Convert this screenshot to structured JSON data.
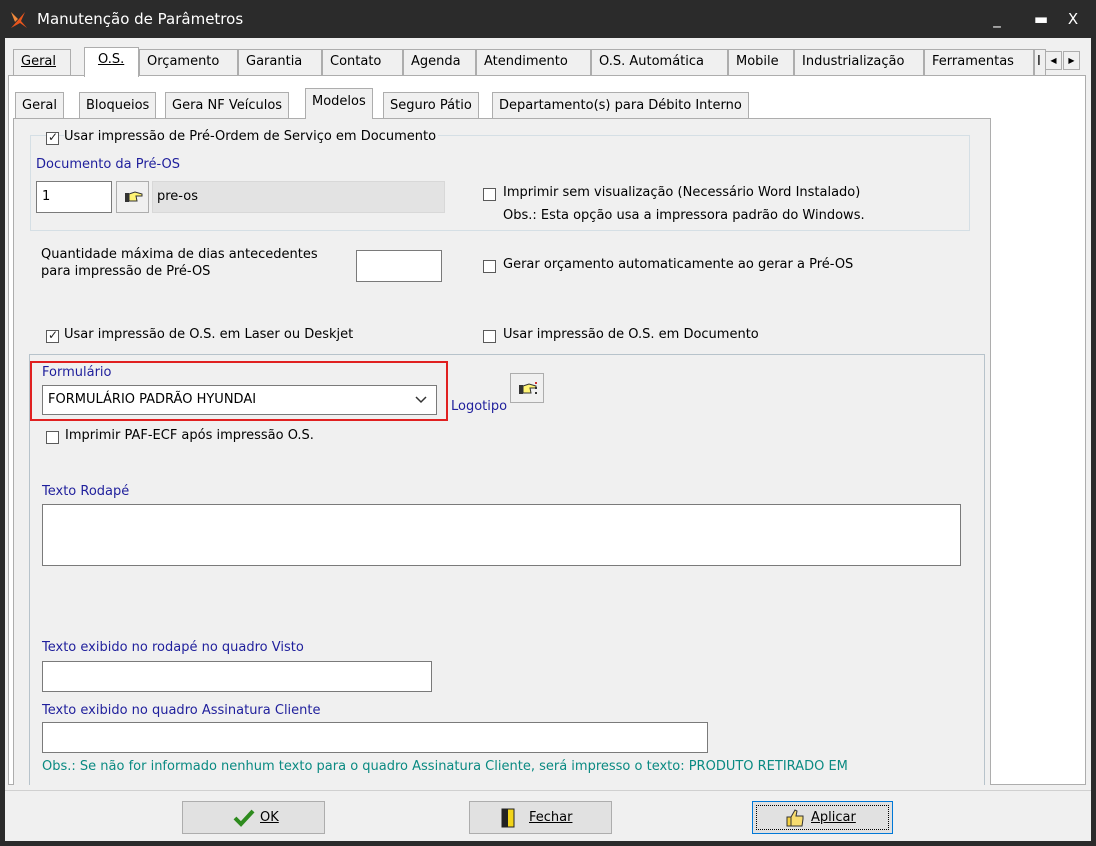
{
  "window": {
    "title": "Manutenção de Parâmetros",
    "controls": [
      "_",
      "▬",
      "X"
    ]
  },
  "outer_tabs": [
    "Geral",
    "O.S.",
    "Orçamento",
    "Garantia",
    "Contato",
    "Agenda",
    "Atendimento",
    "O.S. Automática",
    "Mobile",
    "Industrialização",
    "Ferramentas",
    "I"
  ],
  "outer_active": "O.S.",
  "inner_tabs": [
    "Geral",
    "Bloqueios",
    "Gera NF Veículos",
    "Modelos",
    "Seguro Pátio",
    "Departamento(s) para Débito Interno"
  ],
  "inner_active": "Modelos",
  "pre_os": {
    "checkbox_label": "Usar impressão de Pré-Ordem de Serviço em Documento",
    "checked": true,
    "doc_label": "Documento da Pré-OS",
    "doc_code": "1",
    "doc_name": "pre-os",
    "print_no_preview_label": "Imprimir sem visualização (Necessário Word Instalado)",
    "print_no_preview_checked": false,
    "print_note": "Obs.: Esta opção usa a impressora padrão do Windows."
  },
  "max_days": {
    "label_line1": "Quantidade máxima de dias antecedentes",
    "label_line2": "para impressão de Pré-OS",
    "value": ""
  },
  "gen_budget": {
    "label": "Gerar orçamento automaticamente ao gerar a Pré-OS",
    "checked": false
  },
  "laser": {
    "label": "Usar impressão de O.S. em Laser ou Deskjet",
    "checked": true
  },
  "os_doc": {
    "label": "Usar impressão de O.S. em Documento",
    "checked": false
  },
  "form": {
    "label": "Formulário",
    "selected": "FORMULÁRIO PADRÃO HYUNDAI",
    "logo_label": "Logotipo",
    "highlight_color": "#e02020"
  },
  "paf": {
    "label": "Imprimir PAF-ECF após impressão O.S.",
    "checked": false
  },
  "footer_text": {
    "label": "Texto Rodapé",
    "value": ""
  },
  "visto": {
    "label": "Texto exibido no rodapé no quadro Visto",
    "value": ""
  },
  "assinatura": {
    "label": "Texto exibido no quadro Assinatura Cliente",
    "value": ""
  },
  "obs_note": "Obs.: Se não for informado nenhum texto para o quadro Assinatura Cliente, será impresso o texto: PRODUTO RETIRADO EM",
  "buttons": {
    "ok": "OK",
    "close": "Fechar",
    "apply": "Aplicar"
  },
  "colors": {
    "label_blue": "#1f1f9c",
    "note_teal": "#0a8a82",
    "titlebar": "#2b2b2b"
  }
}
